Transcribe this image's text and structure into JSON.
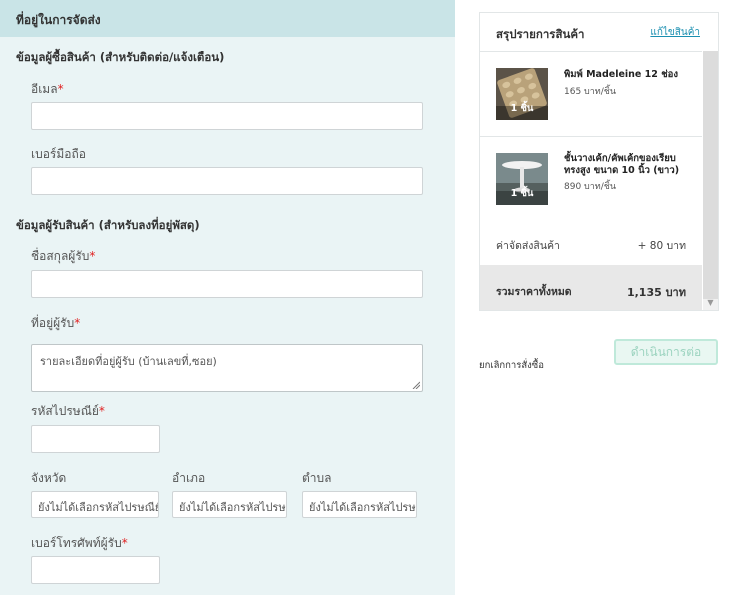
{
  "form": {
    "header_title": "ที่อยู่ในการจัดส่ง",
    "buyer_section_title": "ข้อมูลผู้ซื้อสินค้า (สำหรับติดต่อ/แจ้งเตือน)",
    "email": {
      "label": "อีเมล",
      "required_mark": "*",
      "value": ""
    },
    "mobile": {
      "label": "เบอร์มือถือ",
      "value": ""
    },
    "recipient_section_title": "ข้อมูลผู้รับสินค้า (สำหรับลงที่อยู่พัสดุ)",
    "recipient_name": {
      "label": "ชื่อสกุลผู้รับ",
      "required_mark": "*",
      "value": ""
    },
    "recipient_address": {
      "label": "ที่อยู่ผู้รับ",
      "required_mark": "*",
      "placeholder": "รายละเอียดที่อยู่ผู้รับ (บ้านเลขที่,ซอย)"
    },
    "postcode": {
      "label": "รหัสไปรษณีย์",
      "required_mark": "*",
      "value": ""
    },
    "province": {
      "label": "จังหวัด",
      "value": "ยังไม่ได้เลือกรหัสไปรษณีย์"
    },
    "district": {
      "label": "อำเภอ",
      "value": "ยังไม่ได้เลือกรหัสไปรษณีย์"
    },
    "subdistrict": {
      "label": "ตำบล",
      "value": "ยังไม่ได้เลือกรหัสไปรษณีย์"
    },
    "phone": {
      "label": "เบอร์โทรศัพท์ผู้รับ",
      "required_mark": "*",
      "value": ""
    }
  },
  "summary": {
    "title": "สรุปรายการสินค้า",
    "edit_link": "แก้ไขสินค้า",
    "items": [
      {
        "name": "พิมพ์ Madeleine 12 ช่อง",
        "price": "165 บาท/ชิ้น",
        "qty": "1 ชิ้น",
        "icon": "madeleine-mold-thumbnail"
      },
      {
        "name": "ชั้นวางเค้ก/คัพเค้กของเรียบ ทรงสูง ขนาด 10 นิ้ว (ขาว)",
        "price": "890 บาท/ชิ้น",
        "qty": "1 ชิ้น",
        "icon": "cake-stand-thumbnail"
      }
    ],
    "shipping_label": "ค่าจัดส่งสินค้า",
    "shipping_value": "+ 80 บาท",
    "total_label": "รวมราคาทั้งหมด",
    "total_value": "1,135 บาท"
  },
  "actions": {
    "cancel": "ยกเลิกการสั่งซื้อ",
    "proceed": "ดำเนินการต่อ"
  },
  "colors": {
    "form_bg": "#eaf4f5",
    "header_bg": "#c9e4e7",
    "required": "#e02020",
    "link": "#1a8fb0",
    "proceed_border": "#bfe9da"
  }
}
